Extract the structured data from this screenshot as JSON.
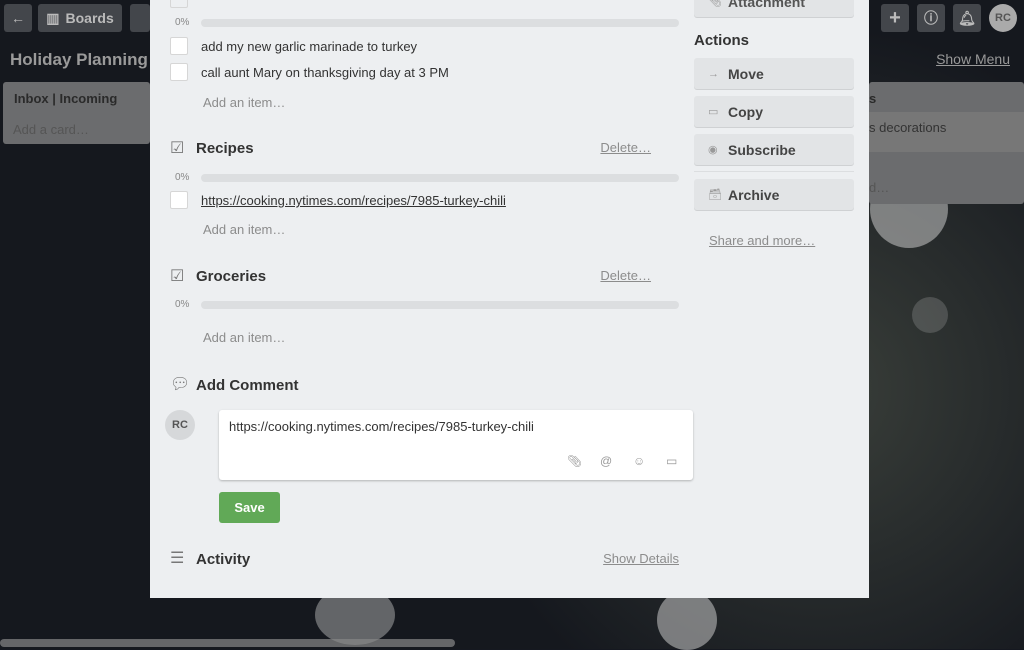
{
  "header": {
    "back_icon": "back-arrow-icon",
    "boards_label": "Boards",
    "avatar_initials": "RC"
  },
  "board": {
    "title": "Holiday Planning",
    "show_menu": "Show Menu",
    "lists": [
      {
        "title": "Inbox | Incoming",
        "add_card": "Add a card…"
      },
      {
        "title_partial": "s",
        "card_partial": "s decorations",
        "add_partial": "d…"
      }
    ]
  },
  "checklists": [
    {
      "title": "",
      "percent": "0%",
      "progress": 0,
      "items": [
        "add my new garlic marinade to turkey",
        "call aunt Mary on thanksgiving day at 3 PM"
      ],
      "add_item": "Add an item…"
    },
    {
      "title": "Recipes",
      "delete": "Delete…",
      "percent": "0%",
      "progress": 0,
      "items": [
        "https://cooking.nytimes.com/recipes/7985-turkey-chili"
      ],
      "add_item": "Add an item…"
    },
    {
      "title": "Groceries",
      "delete": "Delete…",
      "percent": "0%",
      "progress": 0,
      "items": [],
      "add_item": "Add an item…"
    }
  ],
  "comment": {
    "title": "Add Comment",
    "avatar": "RC",
    "value": "https://cooking.nytimes.com/recipes/7985-turkey-chili",
    "save": "Save"
  },
  "activity": {
    "title": "Activity",
    "show_details": "Show Details"
  },
  "sidebar": {
    "attachment": "Attachment",
    "actions_title": "Actions",
    "move": "Move",
    "copy": "Copy",
    "subscribe": "Subscribe",
    "archive": "Archive",
    "share": "Share and more…"
  },
  "colors": {
    "save": "#61a957",
    "modal_bg": "#edeff1"
  }
}
